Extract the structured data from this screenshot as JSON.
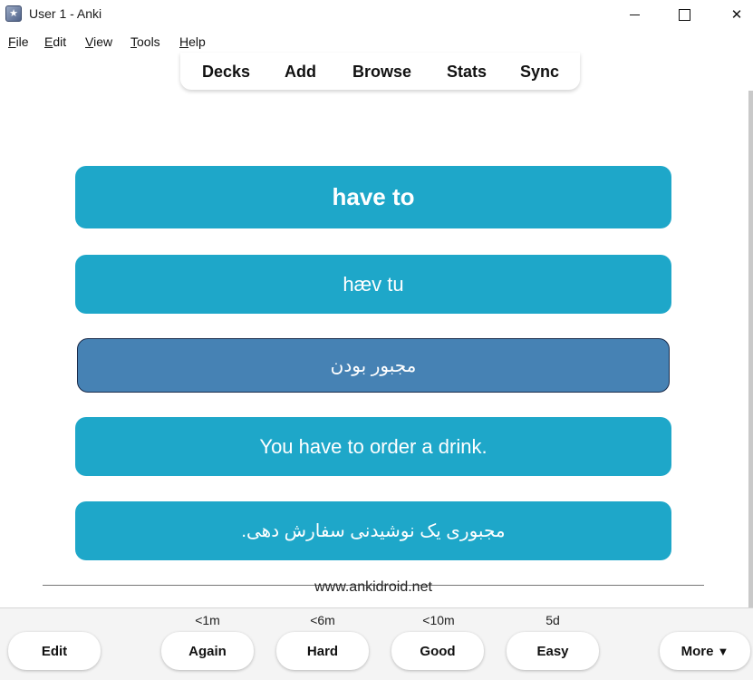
{
  "window": {
    "title": "User 1 - Anki",
    "app_icon": "anki-star-icon",
    "close_glyph": "✕"
  },
  "menu": {
    "file": {
      "accel": "F",
      "rest": "ile"
    },
    "edit": {
      "accel": "E",
      "rest": "dit"
    },
    "view": {
      "accel": "V",
      "rest": "iew"
    },
    "tools": {
      "accel": "T",
      "rest": "ools"
    },
    "help": {
      "accel": "H",
      "rest": "elp"
    }
  },
  "toolbar": {
    "decks": "Decks",
    "add": "Add",
    "browse": "Browse",
    "stats": "Stats",
    "sync": "Sync"
  },
  "card": {
    "word": "have to",
    "ipa": "hæv tu",
    "meaning": "مجبور بودن",
    "example": "You have to order a drink.",
    "translation": "مجبوری یک نوشیدنی سفارش دهی."
  },
  "footer_link": "www.ankidroid.net",
  "bottom": {
    "edit_label": "Edit",
    "more_label": "More",
    "more_arrow": "▼",
    "answers": [
      {
        "label": "Again",
        "interval": "<1m"
      },
      {
        "label": "Hard",
        "interval": "<6m"
      },
      {
        "label": "Good",
        "interval": "<10m"
      },
      {
        "label": "Easy",
        "interval": "5d"
      }
    ]
  },
  "colors": {
    "card_bg": "#1ea7c9",
    "meaning_bg": "#4682b4",
    "text_on_card": "#ffffff"
  }
}
